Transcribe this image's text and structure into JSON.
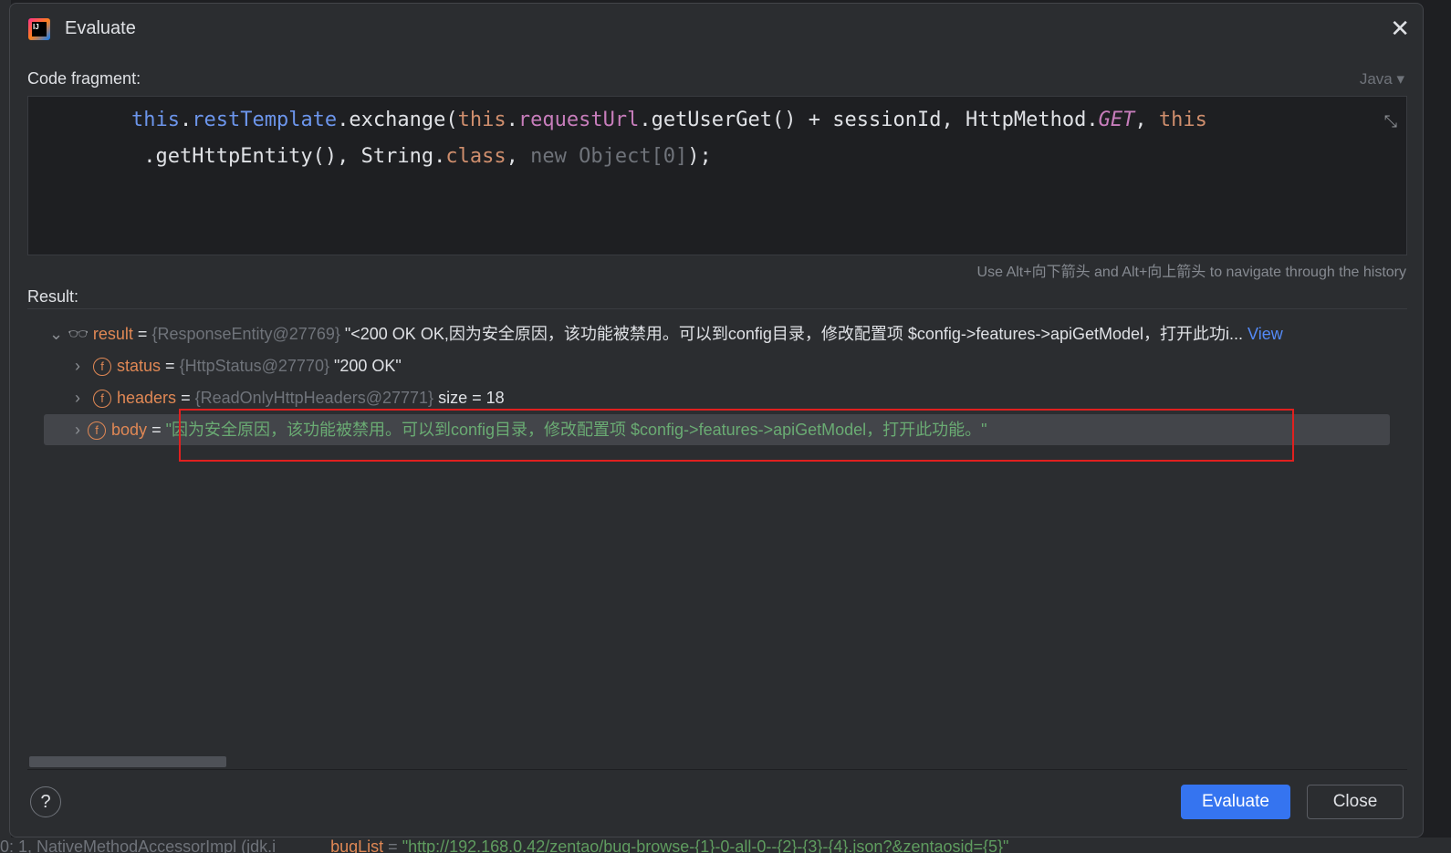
{
  "dialog": {
    "title": "Evaluate",
    "code_label": "Code fragment:",
    "language": "Java",
    "code": {
      "l1a": "this",
      "l1b": ".",
      "l1c": "restTemplate",
      "l1d": ".exchange(",
      "l1e": "this",
      "l1f": ".",
      "l1g": "requestUrl",
      "l1h": ".getUserGet() + sessionId, HttpMethod.",
      "l1i": "GET",
      "l1j": ", ",
      "l1k": "this",
      "l2a": " .getHttpEntity(), String.",
      "l2b": "class",
      "l2c": ", ",
      "l2d": "new Object[0]",
      "l2e": ");"
    },
    "history_hint": "Use Alt+向下箭头 and Alt+向上箭头 to navigate through the history",
    "result_label": "Result:",
    "tree": [
      {
        "name": "result",
        "type": "{ResponseEntity@27769}",
        "value": "\"<200 OK OK,因为安全原因，该功能被禁用。可以到config目录，修改配置项 $config->features->apiGetModel，打开此功i...",
        "link": "View"
      },
      {
        "name": "status",
        "type": "{HttpStatus@27770}",
        "value": "\"200 OK\""
      },
      {
        "name": "headers",
        "type": "{ReadOnlyHttpHeaders@27771}",
        "value": "size = 18"
      },
      {
        "name": "body",
        "value": "\"因为安全原因，该功能被禁用。可以到config目录，修改配置项 $config->features->apiGetModel，打开此功能。\""
      }
    ],
    "eq": "=",
    "help": "?",
    "evaluate_button": "Evaluate",
    "close_button": "Close"
  },
  "background": {
    "left": "0: 1, NativeMethodAccessorImpl (jdk.i",
    "var": "bugList",
    "val": "\"http://192.168.0.42/zentao/bug-browse-{1}-0-all-0--{2}-{3}-{4}.json?&zentaosid={5}\""
  }
}
